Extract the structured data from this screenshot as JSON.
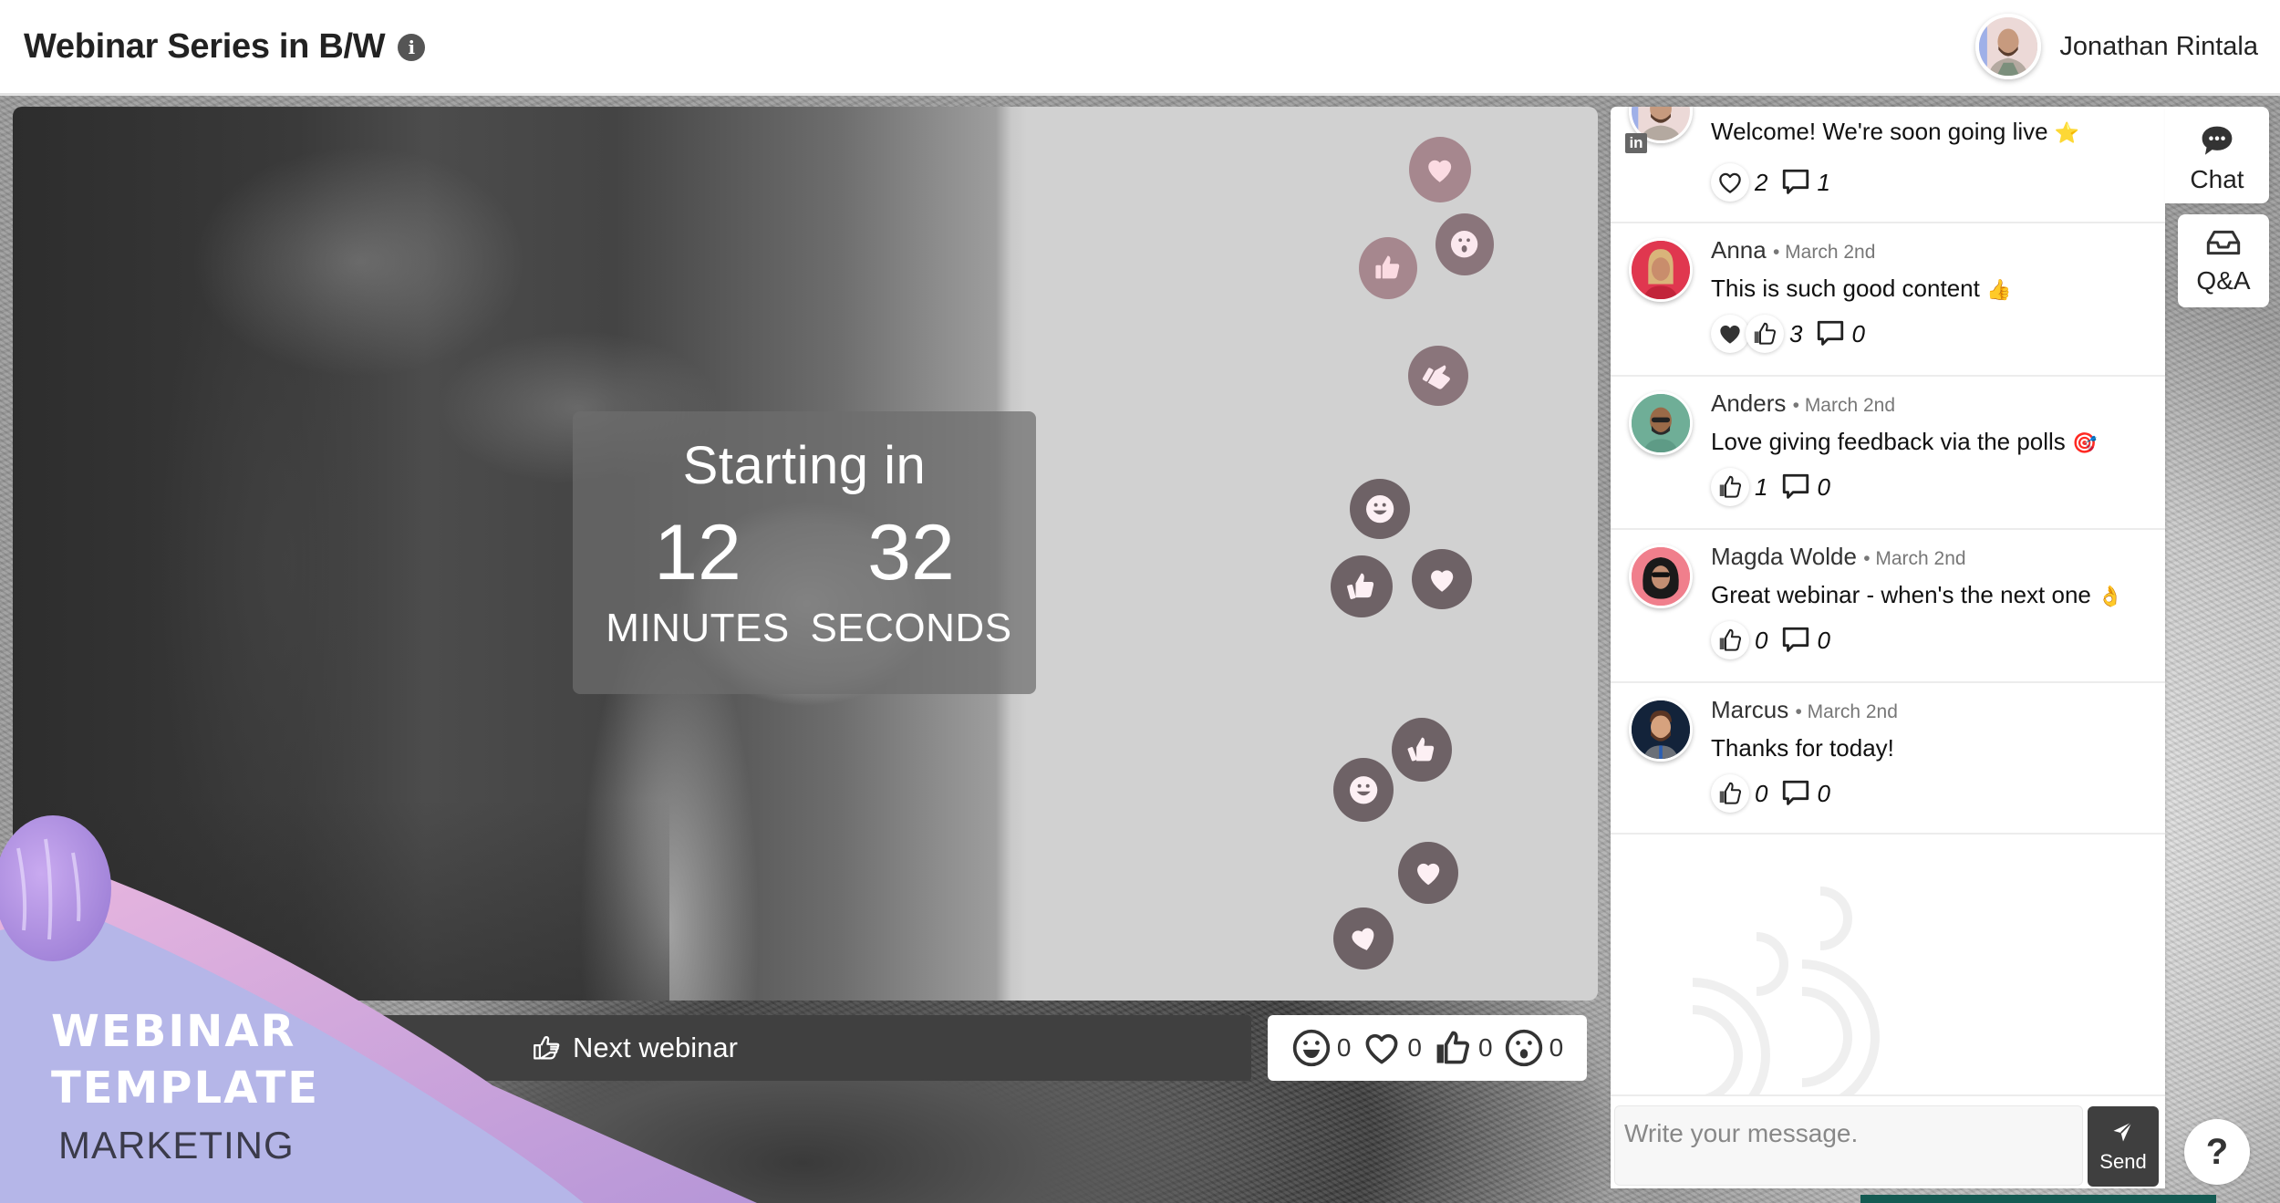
{
  "header": {
    "title": "Webinar Series in B/W",
    "info_icon": "info-icon",
    "user_name": "Jonathan Rintala"
  },
  "countdown": {
    "title": "Starting in",
    "minutes": "12",
    "minutes_label": "MINUTES",
    "seconds": "32",
    "seconds_label": "SECONDS"
  },
  "floating_reactions": [
    "heart",
    "thumbs-up",
    "surprised",
    "thumbs-up",
    "laugh",
    "thumbs-up",
    "heart",
    "thumbs-up",
    "laugh",
    "heart",
    "heart"
  ],
  "branding": {
    "line1": "WEBINAR",
    "line2": "TEMPLATE",
    "line3": "MARKETING",
    "colors": {
      "lavender": "#b5b6e8",
      "pink": "#d9a8dc",
      "purple": "#b89ad8"
    }
  },
  "next_webinar": {
    "icon": "pointing-hand-icon",
    "label": "Next webinar"
  },
  "reactions": [
    {
      "icon": "laugh-icon",
      "count": "0"
    },
    {
      "icon": "heart-icon",
      "count": "0"
    },
    {
      "icon": "thumbs-up-icon",
      "count": "0"
    },
    {
      "icon": "surprised-icon",
      "count": "0"
    }
  ],
  "chat": {
    "messages": [
      {
        "author": "",
        "date": "",
        "text": "Welcome! We're soon going live",
        "emoji": "⭐",
        "reactions": [
          "heart"
        ],
        "reaction_count": "2",
        "reply_count": "1",
        "badge": "in"
      },
      {
        "author": "Anna",
        "date": "March 2nd",
        "text": "This is such good content",
        "emoji": "👍",
        "reactions": [
          "heart-filled",
          "thumbs-up"
        ],
        "reaction_count": "3",
        "reply_count": "0"
      },
      {
        "author": "Anders",
        "date": "March 2nd",
        "text": "Love giving feedback via the polls",
        "emoji": "🎯",
        "reactions": [
          "thumbs-up"
        ],
        "reaction_count": "1",
        "reply_count": "0"
      },
      {
        "author": "Magda Wolde",
        "date": "March 2nd",
        "text": "Great webinar - when's the next one",
        "emoji": "👌",
        "reactions": [
          "thumbs-up"
        ],
        "reaction_count": "0",
        "reply_count": "0"
      },
      {
        "author": "Marcus",
        "date": "March 2nd",
        "text": "Thanks for today!",
        "emoji": "",
        "reactions": [
          "thumbs-up"
        ],
        "reaction_count": "0",
        "reply_count": "0"
      }
    ],
    "input_placeholder": "Write your message.",
    "send_label": "Send"
  },
  "side_tabs": [
    {
      "label": "Chat",
      "icon": "chat-bubble-icon",
      "active": true
    },
    {
      "label": "Q&A",
      "icon": "inbox-icon",
      "active": false
    }
  ],
  "help_label": "?"
}
